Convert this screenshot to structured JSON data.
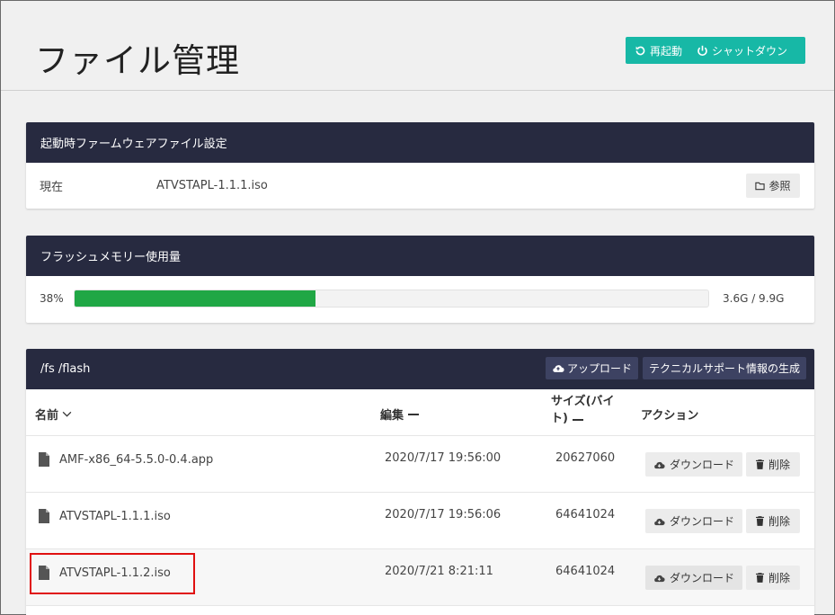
{
  "header": {
    "title": "ファイル管理",
    "restart_label": "再起動",
    "shutdown_label": "シャットダウン"
  },
  "firmware": {
    "heading": "起動時ファームウェアファイル設定",
    "label": "現在",
    "value": "ATVSTAPL-1.1.1.iso",
    "browse_label": "参照"
  },
  "flash": {
    "heading": "フラッシュメモリー使用量",
    "percent_text": "38%",
    "percent_value": 38,
    "size_text": "3.6G / 9.9G",
    "bar_color": "#20a745"
  },
  "files": {
    "path": "/fs /flash",
    "upload_label": "アップロード",
    "support_label": "テクニカルサポート情報の生成",
    "columns": {
      "name": "名前",
      "edit": "編集",
      "size": "サイズ(バイト)",
      "action": "アクション"
    },
    "rows": [
      {
        "name": "AMF-x86_64-5.5.0-0.4.app",
        "date": "2020/7/17 19:56:00",
        "size": "20627060"
      },
      {
        "name": "ATVSTAPL-1.1.1.iso",
        "date": "2020/7/17 19:56:06",
        "size": "64641024"
      },
      {
        "name": "ATVSTAPL-1.1.2.iso",
        "date": "2020/7/21 8:21:11",
        "size": "64641024"
      }
    ],
    "download_label": "ダウンロード",
    "delete_label": "削除"
  },
  "colors": {
    "accent": "#17b8a6",
    "panel_header": "#272a40",
    "highlight": "#e01010"
  }
}
